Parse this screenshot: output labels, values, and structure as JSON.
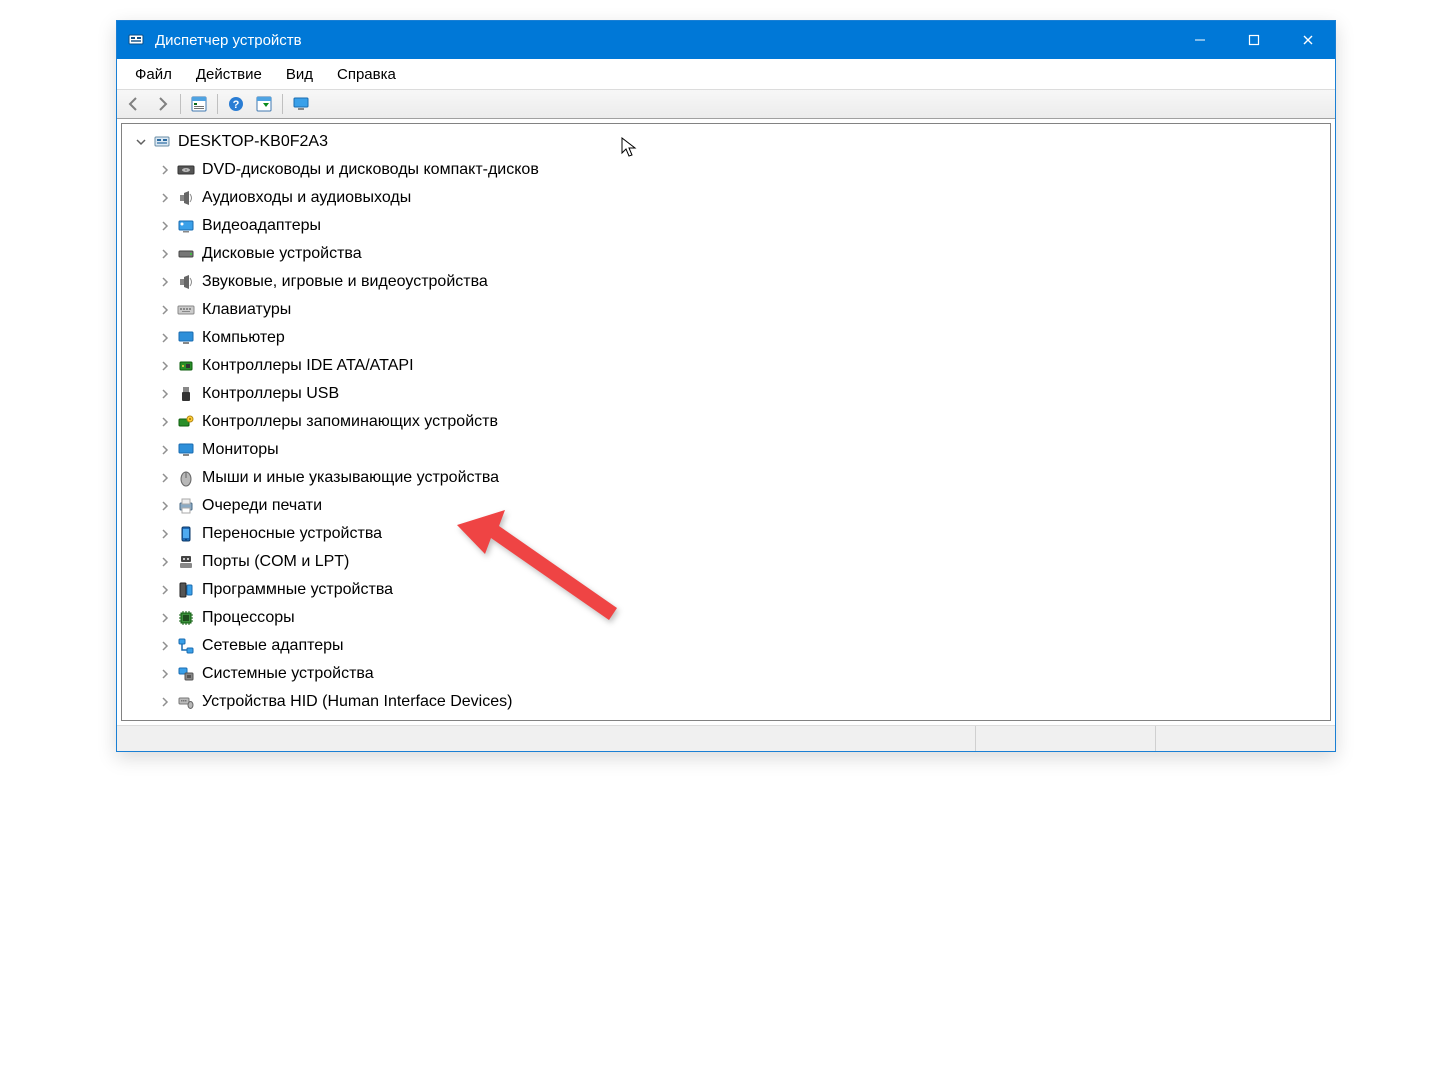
{
  "window": {
    "title": "Диспетчер устройств"
  },
  "menu": {
    "file": "Файл",
    "action": "Действие",
    "view": "Вид",
    "help": "Справка"
  },
  "toolbar_icons": {
    "back": "back-icon",
    "forward": "forward-icon",
    "props": "properties-icon",
    "help": "help-icon",
    "scan": "scan-icon",
    "monitor": "monitor-icon"
  },
  "tree": {
    "root": "DESKTOP-KB0F2A3",
    "categories": [
      {
        "label": "DVD-дисководы и дисководы компакт-дисков",
        "icon": "disc"
      },
      {
        "label": "Аудиовходы и аудиовыходы",
        "icon": "speaker"
      },
      {
        "label": "Видеоадаптеры",
        "icon": "display"
      },
      {
        "label": "Дисковые устройства",
        "icon": "hdd"
      },
      {
        "label": "Звуковые, игровые и видеоустройства",
        "icon": "speaker"
      },
      {
        "label": "Клавиатуры",
        "icon": "keyboard"
      },
      {
        "label": "Компьютер",
        "icon": "monitor"
      },
      {
        "label": "Контроллеры IDE ATA/ATAPI",
        "icon": "chip-green"
      },
      {
        "label": "Контроллеры USB",
        "icon": "usb"
      },
      {
        "label": "Контроллеры запоминающих устройств",
        "icon": "storage-ctrl"
      },
      {
        "label": "Мониторы",
        "icon": "monitor"
      },
      {
        "label": "Мыши и иные указывающие устройства",
        "icon": "mouse"
      },
      {
        "label": "Очереди печати",
        "icon": "printer"
      },
      {
        "label": "Переносные устройства",
        "icon": "phone"
      },
      {
        "label": "Порты (COM и LPT)",
        "icon": "port"
      },
      {
        "label": "Программные устройства",
        "icon": "chip-gray"
      },
      {
        "label": "Процессоры",
        "icon": "cpu"
      },
      {
        "label": "Сетевые адаптеры",
        "icon": "network"
      },
      {
        "label": "Системные устройства",
        "icon": "system"
      },
      {
        "label": "Устройства HID (Human Interface Devices)",
        "icon": "hid"
      }
    ]
  },
  "annotation": {
    "arrow_target_index": 13,
    "arrow_color": "#ef4444"
  }
}
